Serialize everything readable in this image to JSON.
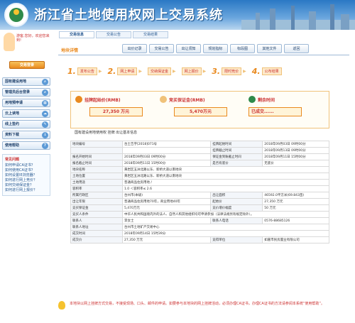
{
  "header": {
    "title": "浙江省土地使用权网上交易系统"
  },
  "top_tabs": [
    {
      "label": "交易信息"
    },
    {
      "label": "交易公告"
    },
    {
      "label": "交易结果"
    }
  ],
  "sidebar": {
    "greet": "游客,您好，欢迎您来到!",
    "login_button": "交易登录",
    "items": [
      {
        "label": "国有建设用地"
      },
      {
        "label": "管理员后台登录"
      },
      {
        "label": "用地预申请"
      },
      {
        "label": "云上读地"
      },
      {
        "label": "线上签约"
      },
      {
        "label": "资料下载"
      },
      {
        "label": "使用帮助"
      }
    ],
    "faq_title": "常见问题",
    "faq": [
      {
        "label": "如何申请CA证书？"
      },
      {
        "label": "如何使用CA证书？"
      },
      {
        "label": "如何设置IE浏览器？"
      },
      {
        "label": "如何进行网上竞价？"
      },
      {
        "label": "如何交纳保证金？"
      },
      {
        "label": "如何进行网上报价？"
      }
    ]
  },
  "nav": {
    "brand": "地块详情",
    "buttons": [
      {
        "label": "出价记录"
      },
      {
        "label": "交易公告"
      },
      {
        "label": "出让须知"
      },
      {
        "label": "规划指标"
      },
      {
        "label": "标段图"
      },
      {
        "label": "其他文件"
      },
      {
        "label": "返回"
      }
    ]
  },
  "steps": [
    {
      "num": "1.",
      "label": "发布公告"
    },
    {
      "num": "2.",
      "label": "网上申请"
    },
    {
      "num": "",
      "label": "交纳保证金"
    },
    {
      "num": "",
      "label": "网上报价"
    },
    {
      "num": "3.",
      "label": "限时竞价"
    },
    {
      "num": "4.",
      "label": "公布结果"
    }
  ],
  "info": {
    "start_price_label": "挂牌起始价(RMB)",
    "start_price_value": "27,350 万元",
    "deposit_label": "竞买保证金(RMB)",
    "deposit_value": "5,470万元",
    "remain_label": "剩余时间",
    "remain_value": "已成交......"
  },
  "subtitle": "国有建设用地使用权  挂牌  出让基本信息",
  "rows": [
    [
      "地块编号",
      "台土告字[2018]071号",
      "挂牌起始时间",
      "2018年09月03日 09时00分"
    ],
    [
      "",
      "",
      "挂牌截止时间",
      "2018年09月13日 09时00分"
    ],
    [
      "报名开始时间",
      "2018年09月03日 09时00分",
      "保证金到账截止时间",
      "2018年09月11日 15时00分"
    ],
    [
      "报名截止时间",
      "2018年09月11日 15时00分",
      "是否有底价",
      "无底价"
    ],
    [
      "地块名称",
      "黄岩区五洲北路以东、新桥大道以南地块",
      "",
      ""
    ],
    [
      "土地位置",
      "黄岩区五洲北路以东、新桥大道以南地块",
      "",
      ""
    ],
    [
      "土地用途",
      "普通商品住房用地 /",
      "",
      ""
    ],
    [
      "容积率",
      "1.0 ＜容积率≤ 2.6",
      "",
      ""
    ],
    [
      "所属行政区",
      "台州市(本级)",
      "出让面积",
      "46592.0平方米(69.843亩)"
    ],
    [
      "出让年限",
      "普通商品住房用地70年，商业用地40年",
      "起始价",
      "27,350 万元"
    ],
    [
      "竞买保证金",
      "5,470万元",
      "竞价增价幅度",
      "50 万元"
    ],
    [
      "竞买人条件",
      "中华人民共和国境内外的法人、自然人和其他组织均可申请参加（法律法规另有规定除外）。",
      "",
      ""
    ],
    [
      "联系人",
      "李女士",
      "联系人电话",
      "0576-88685126"
    ],
    [
      "联系人地址",
      "台州市土地矿产交易中心",
      "",
      ""
    ],
    [
      "成交时间",
      "2018年09月14日 15时39分",
      "",
      ""
    ],
    [
      "成交价",
      "27,350 万元",
      "竞得单位",
      "如嘉市民房置业有限公司"
    ]
  ],
  "notice": "本地块以网上挂牌方式交易，不接受现场、口头、邮件的申请。如要参与本地块的网上挂牌活动，必须办理CA证书，办理CA证书的方法请参阅本系统“使用帮助”。",
  "colors": {
    "accent": "#e98a1f",
    "brand": "#2a78c4",
    "alert": "#cc3333"
  }
}
